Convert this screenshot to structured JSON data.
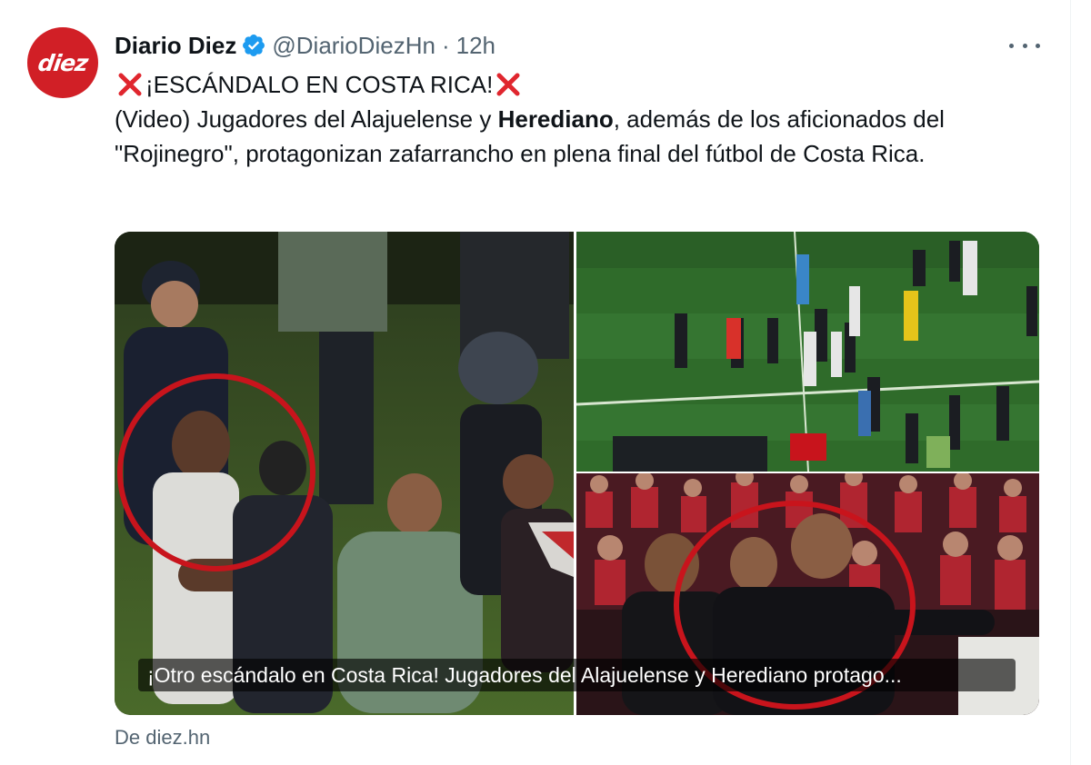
{
  "tweet": {
    "author_name": "Diario Diez",
    "handle": "@DiarioDiezHn",
    "separator": "·",
    "time": "12h",
    "verified": true,
    "avatar_text": "diez",
    "avatar_color": "#d11f26",
    "headline": "¡ESCÁNDALO EN COSTA RICA!",
    "body_part1": "(Video) Jugadores del Alajuelense y ",
    "body_bold": "Herediano",
    "body_part2": ", además de los aficionados del \"Rojinegro\", protagonizan zafarrancho en plena final del fútbol de Costa Rica.",
    "icons": {
      "verified": "verified-badge-icon",
      "more": "more-options-icon",
      "headline_marks": "red-x-icon"
    }
  },
  "card": {
    "caption": "¡Otro escándalo en Costa Rica! Jugadores del Alajuelense y Herediano protago...",
    "source": "De diez.hn",
    "accent_circle_color": "#c8141c"
  },
  "colors": {
    "accent_blue": "#1d9bf0",
    "text": "#0f1419",
    "muted": "#536471"
  }
}
